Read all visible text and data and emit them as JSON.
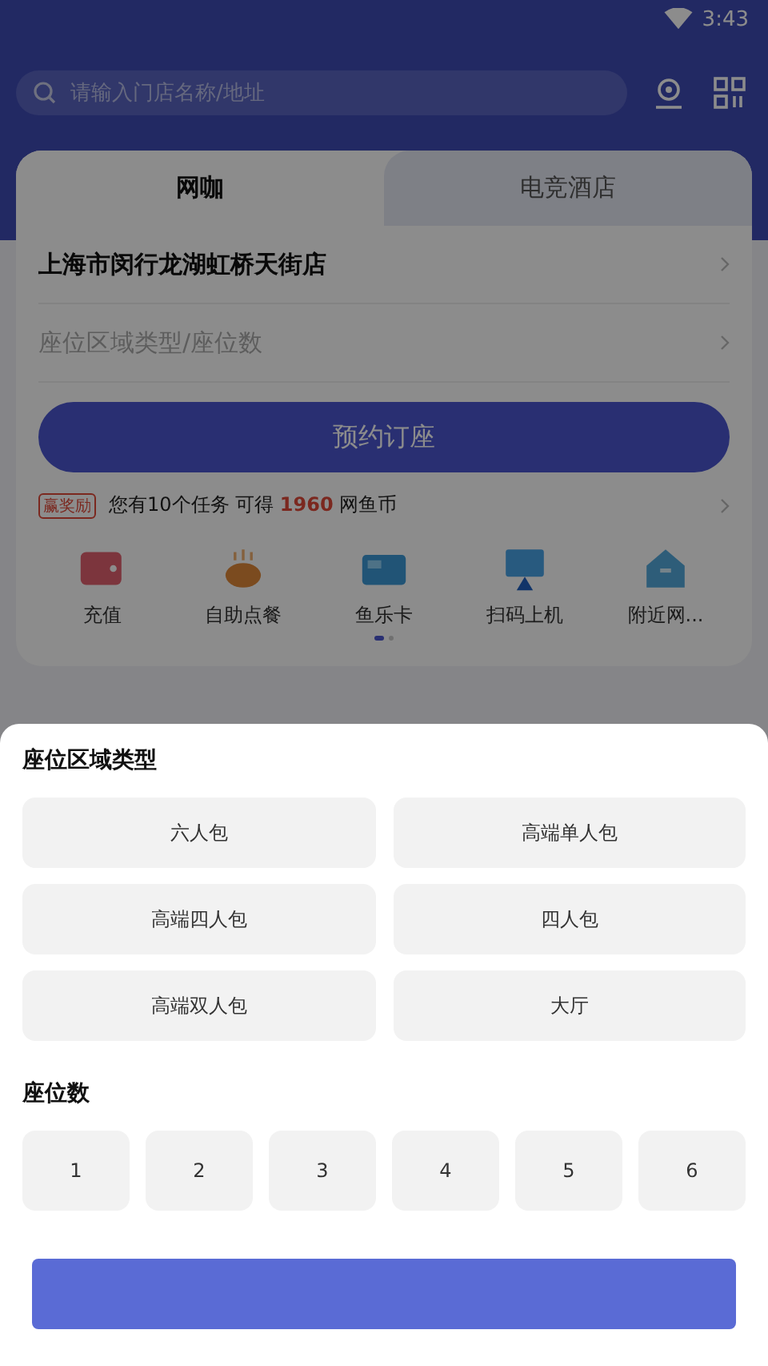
{
  "status_bar": {
    "time": "3:43"
  },
  "search": {
    "placeholder": "请输入门店名称/地址"
  },
  "tabs": [
    {
      "label": "网咖",
      "selected": true
    },
    {
      "label": "电竞酒店",
      "selected": false
    }
  ],
  "store": "上海市闵行龙湖虹桥天街店",
  "seat_field": {
    "placeholder": "座位区域类型/座位数"
  },
  "book_button": "预约订座",
  "tasks": {
    "badge": "赢奖励",
    "text": "您有10个任务 可得 **1960** 网鱼币"
  },
  "shortcuts": [
    {
      "kind": "wallet",
      "label": "充值"
    },
    {
      "kind": "cup",
      "label": "自助点餐"
    },
    {
      "kind": "card",
      "label": "鱼乐卡"
    },
    {
      "kind": "monitor",
      "label": "扫码上机"
    },
    {
      "kind": "house",
      "label": "附近网..."
    }
  ],
  "pager": [
    {
      "selected": true
    },
    {
      "selected": false
    }
  ],
  "sheet": {
    "zone_title": "座位区域类型",
    "zones": [
      {
        "label": "六人包",
        "selected": false
      },
      {
        "label": "高端单人包",
        "selected": false
      },
      {
        "label": "高端四人包",
        "selected": false
      },
      {
        "label": "四人包",
        "selected": false
      },
      {
        "label": "高端双人包",
        "selected": false
      },
      {
        "label": "大厅",
        "selected": false
      }
    ],
    "count_title": "座位数",
    "counts": [
      {
        "label": "1",
        "selected": false
      },
      {
        "label": "2",
        "selected": false
      },
      {
        "label": "3",
        "selected": false
      },
      {
        "label": "4",
        "selected": false
      },
      {
        "label": "5",
        "selected": false
      },
      {
        "label": "6",
        "selected": false
      }
    ]
  }
}
